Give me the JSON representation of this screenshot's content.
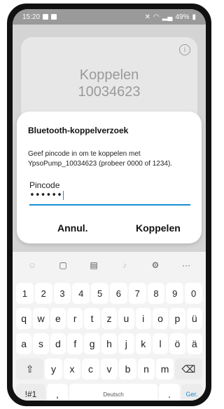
{
  "status_bar": {
    "time": "15:20",
    "battery": "49%"
  },
  "background_card": {
    "title_line1": "Koppelen",
    "title_line2": "10034623"
  },
  "dialog": {
    "title": "Bluetooth-koppelverzoek",
    "message": "Geef pincode in om te koppelen met YpsoPump_10034623 (probeer 0000 of 1234).",
    "pin_label": "Pincode",
    "pin_value": "••••••",
    "cancel_label": "Annul.",
    "pair_label": "Koppelen"
  },
  "keyboard": {
    "toolbar": [
      "emoji-icon",
      "sticker-icon",
      "clipboard-icon",
      "mic-icon",
      "settings-icon",
      "more-icon"
    ],
    "row_numbers": [
      "1",
      "2",
      "3",
      "4",
      "5",
      "6",
      "7",
      "8",
      "9",
      "0"
    ],
    "row_1": [
      "q",
      "w",
      "e",
      "r",
      "t",
      "z",
      "u",
      "i",
      "o",
      "p",
      "ü"
    ],
    "row_2": [
      "a",
      "s",
      "d",
      "f",
      "g",
      "h",
      "j",
      "k",
      "l",
      "ö",
      "ä"
    ],
    "row_3": [
      "y",
      "x",
      "c",
      "v",
      "b",
      "n",
      "m"
    ],
    "symbols_label": "!#1",
    "comma_label": ",",
    "space_label": "Deutsch",
    "period_label": ".",
    "go_label": "Ger."
  },
  "colors": {
    "accent": "#1a8fd6"
  }
}
